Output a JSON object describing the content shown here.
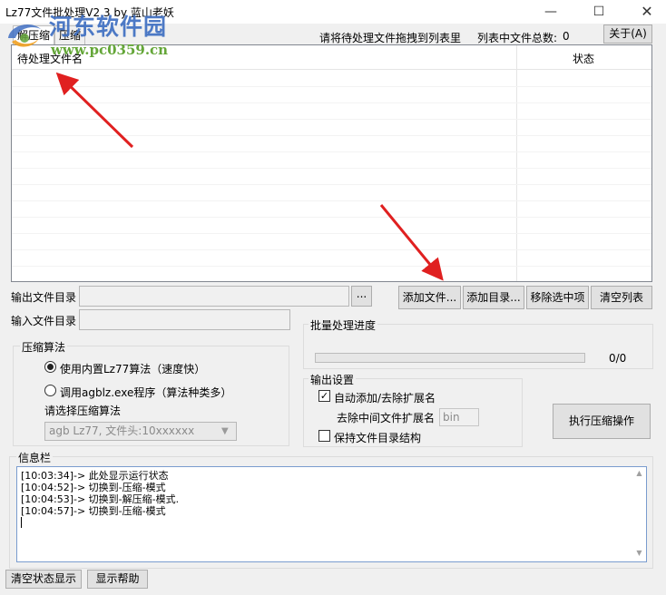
{
  "window": {
    "title": "Lz77文件批处理V2.3 by 蓝山老妖",
    "min_glyph": "—",
    "max_glyph": "☐",
    "close_glyph": "✕"
  },
  "watermark": {
    "title": "河东软件园",
    "url": "www.pc0359.cn"
  },
  "tabs": [
    {
      "label": "解压缩",
      "selected": true
    },
    {
      "label": "压缩",
      "selected": false
    }
  ],
  "header": {
    "drag_hint": "请将待处理文件拖拽到列表里",
    "file_count_label": "列表中文件总数:",
    "file_count_value": "0",
    "about_label": "关于(A)"
  },
  "file_list": {
    "columns": [
      "待处理文件名",
      "状态"
    ],
    "rows": []
  },
  "output_dir": {
    "label": "输出文件目录",
    "value": "",
    "browse_label": "..."
  },
  "input_dir": {
    "label": "输入文件目录",
    "value": ""
  },
  "list_buttons": {
    "add_file": "添加文件...",
    "add_dir": "添加目录...",
    "remove_selected": "移除选中项",
    "clear_list": "清空列表"
  },
  "algorithm": {
    "title": "压缩算法",
    "option_builtin": "使用内置Lz77算法（速度快）",
    "option_external": "调用agblz.exe程序（算法种类多）",
    "selected": "builtin",
    "select_label": "请选择压缩算法",
    "select_value": "agb Lz77, 文件头:10xxxxxx"
  },
  "progress": {
    "title": "批量处理进度",
    "count": "0/0",
    "fraction": 0
  },
  "output_settings": {
    "title": "输出设置",
    "auto_ext_label": "自动添加/去除扩展名",
    "auto_ext_checked": true,
    "strip_ext_label": "去除中间文件扩展名",
    "strip_ext_value": "bin",
    "keep_dir_label": "保持文件目录结构",
    "keep_dir_checked": false
  },
  "execute_label": "执行压缩操作",
  "info": {
    "title": "信息栏",
    "log": [
      "[10:03:34]-> 此处显示运行状态",
      "[10:04:52]-> 切换到-压缩-模式",
      "[10:04:53]-> 切换到-解压缩-模式.",
      "[10:04:57]-> 切换到-压缩-模式"
    ]
  },
  "bottom_buttons": {
    "clear_log": "清空状态显示",
    "help": "显示帮助"
  },
  "colors": {
    "annotation_arrow": "#e02020",
    "watermark_title": "#3f6fc2",
    "watermark_url": "#64a638"
  }
}
